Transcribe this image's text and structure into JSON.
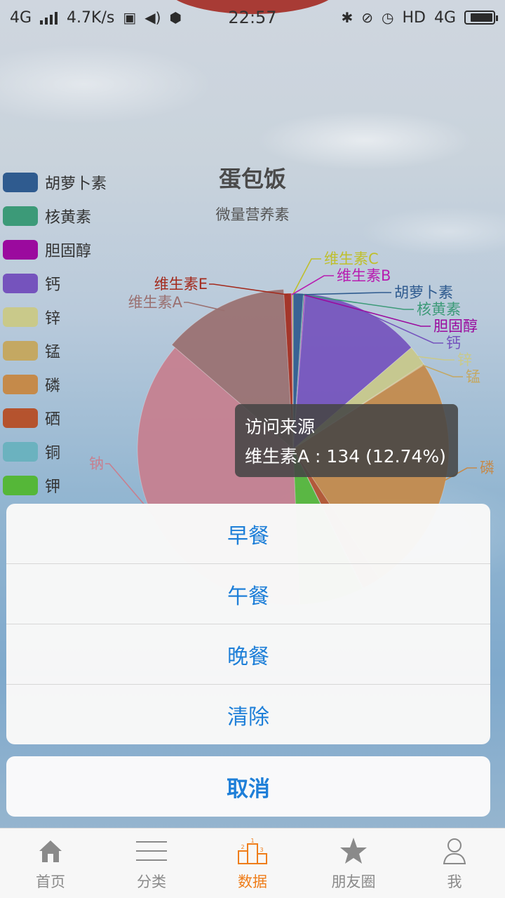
{
  "status_bar": {
    "network": "4G",
    "speed": "4.7K/s",
    "time": "22:57",
    "hd": "HD",
    "network_right": "4G",
    "battery_fraction": 0.85
  },
  "chart_data": {
    "type": "pie",
    "title": "蛋包饭",
    "subtitle": "微量营养素",
    "legend_position": "left",
    "legend": [
      "胡萝卜素",
      "核黄素",
      "胆固醇",
      "钙",
      "锌",
      "锰",
      "磷",
      "硒",
      "铜",
      "钾"
    ],
    "legend_colors": [
      "#2f5b8f",
      "#3c9a78",
      "#9b0a9e",
      "#7553bd",
      "#c9c98a",
      "#c4a862",
      "#c58a4a",
      "#b5532e",
      "#6bb2bf",
      "#55b738"
    ],
    "slices": [
      {
        "name": "胡萝卜素",
        "value": 11,
        "color": "#2f5b8f"
      },
      {
        "name": "核黄素",
        "value": 1,
        "color": "#3c9a78"
      },
      {
        "name": "胆固醇",
        "value": 1,
        "color": "#9b0a9e"
      },
      {
        "name": "钙",
        "value": 131,
        "color": "#7553bd"
      },
      {
        "name": "锌",
        "value": 22,
        "color": "#c9c98a"
      },
      {
        "name": "锰",
        "value": 1,
        "color": "#c4a862"
      },
      {
        "name": "磷",
        "value": 260,
        "color": "#c58a4a"
      },
      {
        "name": "硒",
        "value": 20,
        "color": "#b5532e"
      },
      {
        "name": "铜",
        "value": 1,
        "color": "#6bb2bf"
      },
      {
        "name": "钾",
        "value": 70,
        "color": "#55b738"
      },
      {
        "name": "钠",
        "value": 388,
        "color": "#c77f8f"
      },
      {
        "name": "维生素A",
        "value": 134,
        "color": "#9a7070"
      },
      {
        "name": "维生素E",
        "value": 8,
        "color": "#a32a1c"
      },
      {
        "name": "维生素B",
        "value": 1,
        "color": "#b81cb0"
      },
      {
        "name": "维生素C",
        "value": 1,
        "color": "#bfbf2c"
      }
    ],
    "labels": [
      {
        "text": "维生素C",
        "color": "#bfbf2c"
      },
      {
        "text": "维生素B",
        "color": "#b81cb0"
      },
      {
        "text": "胡萝卜素",
        "color": "#2f5b8f"
      },
      {
        "text": "核黄素",
        "color": "#3c9a78"
      },
      {
        "text": "胆固醇",
        "color": "#9b0a9e"
      },
      {
        "text": "钙",
        "color": "#7553bd"
      },
      {
        "text": "锌",
        "color": "#c9c98a"
      },
      {
        "text": "锰",
        "color": "#c4a862"
      },
      {
        "text": "磷",
        "color": "#c58a4a"
      },
      {
        "text": "钠",
        "color": "#c77f8f"
      },
      {
        "text": "维生素A",
        "color": "#9a7070"
      },
      {
        "text": "维生素E",
        "color": "#a32a1c"
      }
    ]
  },
  "tooltip": {
    "title": "访问来源",
    "text": "维生素A : 134 (12.74%)"
  },
  "action_sheet": {
    "items": [
      "早餐",
      "午餐",
      "晚餐",
      "清除"
    ],
    "cancel": "取消"
  },
  "tabbar": {
    "items": [
      {
        "label": "首页",
        "icon": "home-icon"
      },
      {
        "label": "分类",
        "icon": "menu-lines-icon"
      },
      {
        "label": "数据",
        "icon": "podium-icon"
      },
      {
        "label": "朋友圈",
        "icon": "star-icon"
      },
      {
        "label": "我",
        "icon": "person-icon"
      }
    ],
    "active": "数据"
  }
}
